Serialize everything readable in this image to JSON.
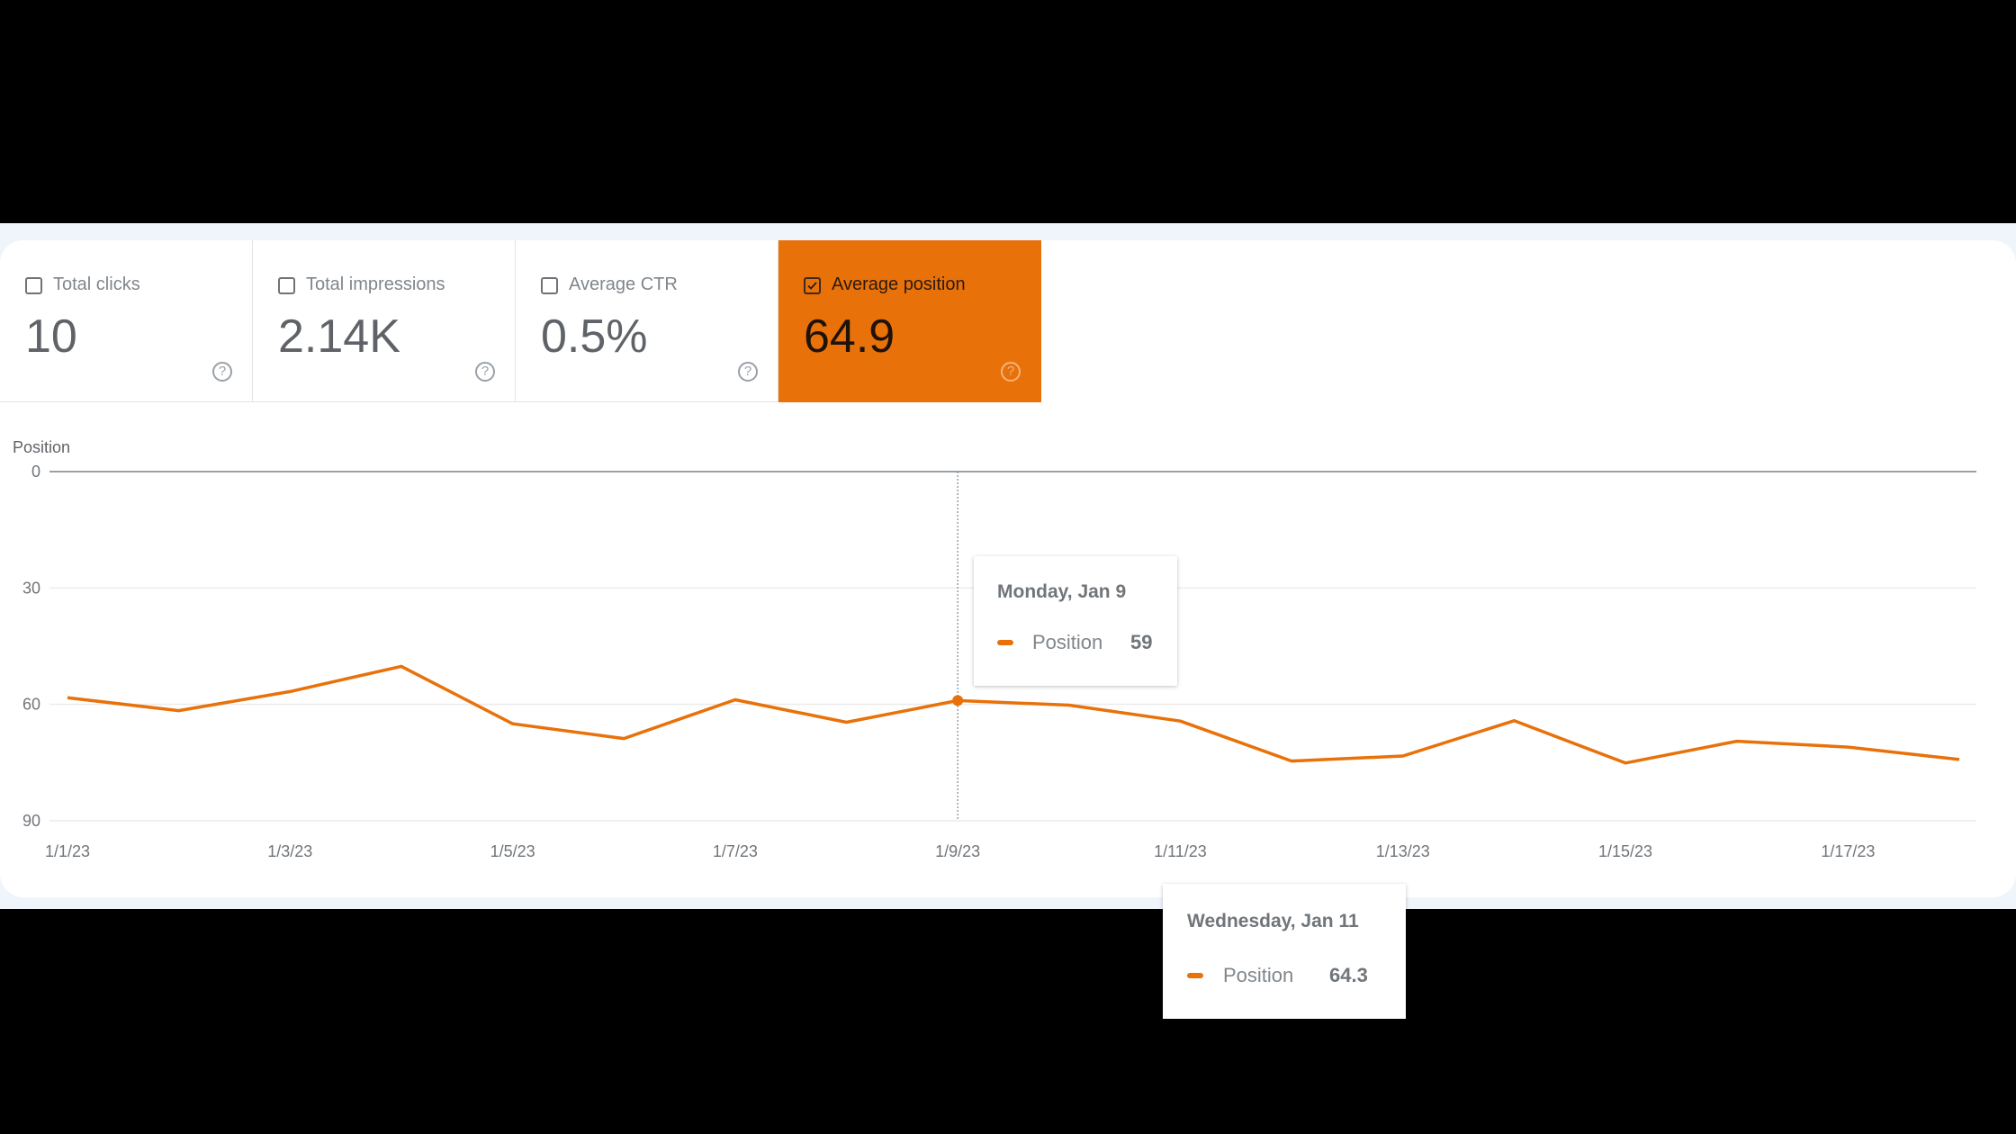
{
  "metrics": [
    {
      "label": "Total clicks",
      "value": "10",
      "checked": false
    },
    {
      "label": "Total impressions",
      "value": "2.14K",
      "checked": false
    },
    {
      "label": "Average CTR",
      "value": "0.5%",
      "checked": false
    },
    {
      "label": "Average position",
      "value": "64.9",
      "checked": true
    }
  ],
  "colors": {
    "accent": "#e8710a"
  },
  "help_glyph": "?",
  "chart_data": {
    "type": "line",
    "title": "",
    "ylabel": "Position",
    "xlabel": "",
    "ylim": [
      0,
      90
    ],
    "y_inverted": true,
    "yticks": [
      0,
      30,
      60,
      90
    ],
    "ytick_labels": [
      "0",
      "30",
      "60",
      "90"
    ],
    "grid": true,
    "x": [
      "1/1/23",
      "1/2/23",
      "1/3/23",
      "1/4/23",
      "1/5/23",
      "1/6/23",
      "1/7/23",
      "1/8/23",
      "1/9/23",
      "1/10/23",
      "1/11/23",
      "1/12/23",
      "1/13/23",
      "1/14/23",
      "1/15/23",
      "1/16/23",
      "1/17/23",
      "1/18/23"
    ],
    "xtick_labels": [
      "1/1/23",
      "1/3/23",
      "1/5/23",
      "1/7/23",
      "1/9/23",
      "1/11/23",
      "1/13/23",
      "1/15/23",
      "1/17/23"
    ],
    "series": [
      {
        "name": "Position",
        "color": "#e8710a",
        "values": [
          58.3,
          61.6,
          56.7,
          50.2,
          65.0,
          68.8,
          58.8,
          64.6,
          59.0,
          60.2,
          64.3,
          74.6,
          73.3,
          64.2,
          75.1,
          69.5,
          71.0,
          74.2
        ]
      }
    ],
    "highlight_index": 8
  },
  "tooltips": [
    {
      "date": "Monday, Jan 9",
      "series": "Position",
      "value": "59"
    },
    {
      "date": "Wednesday, Jan 11",
      "series": "Position",
      "value": "64.3"
    }
  ]
}
